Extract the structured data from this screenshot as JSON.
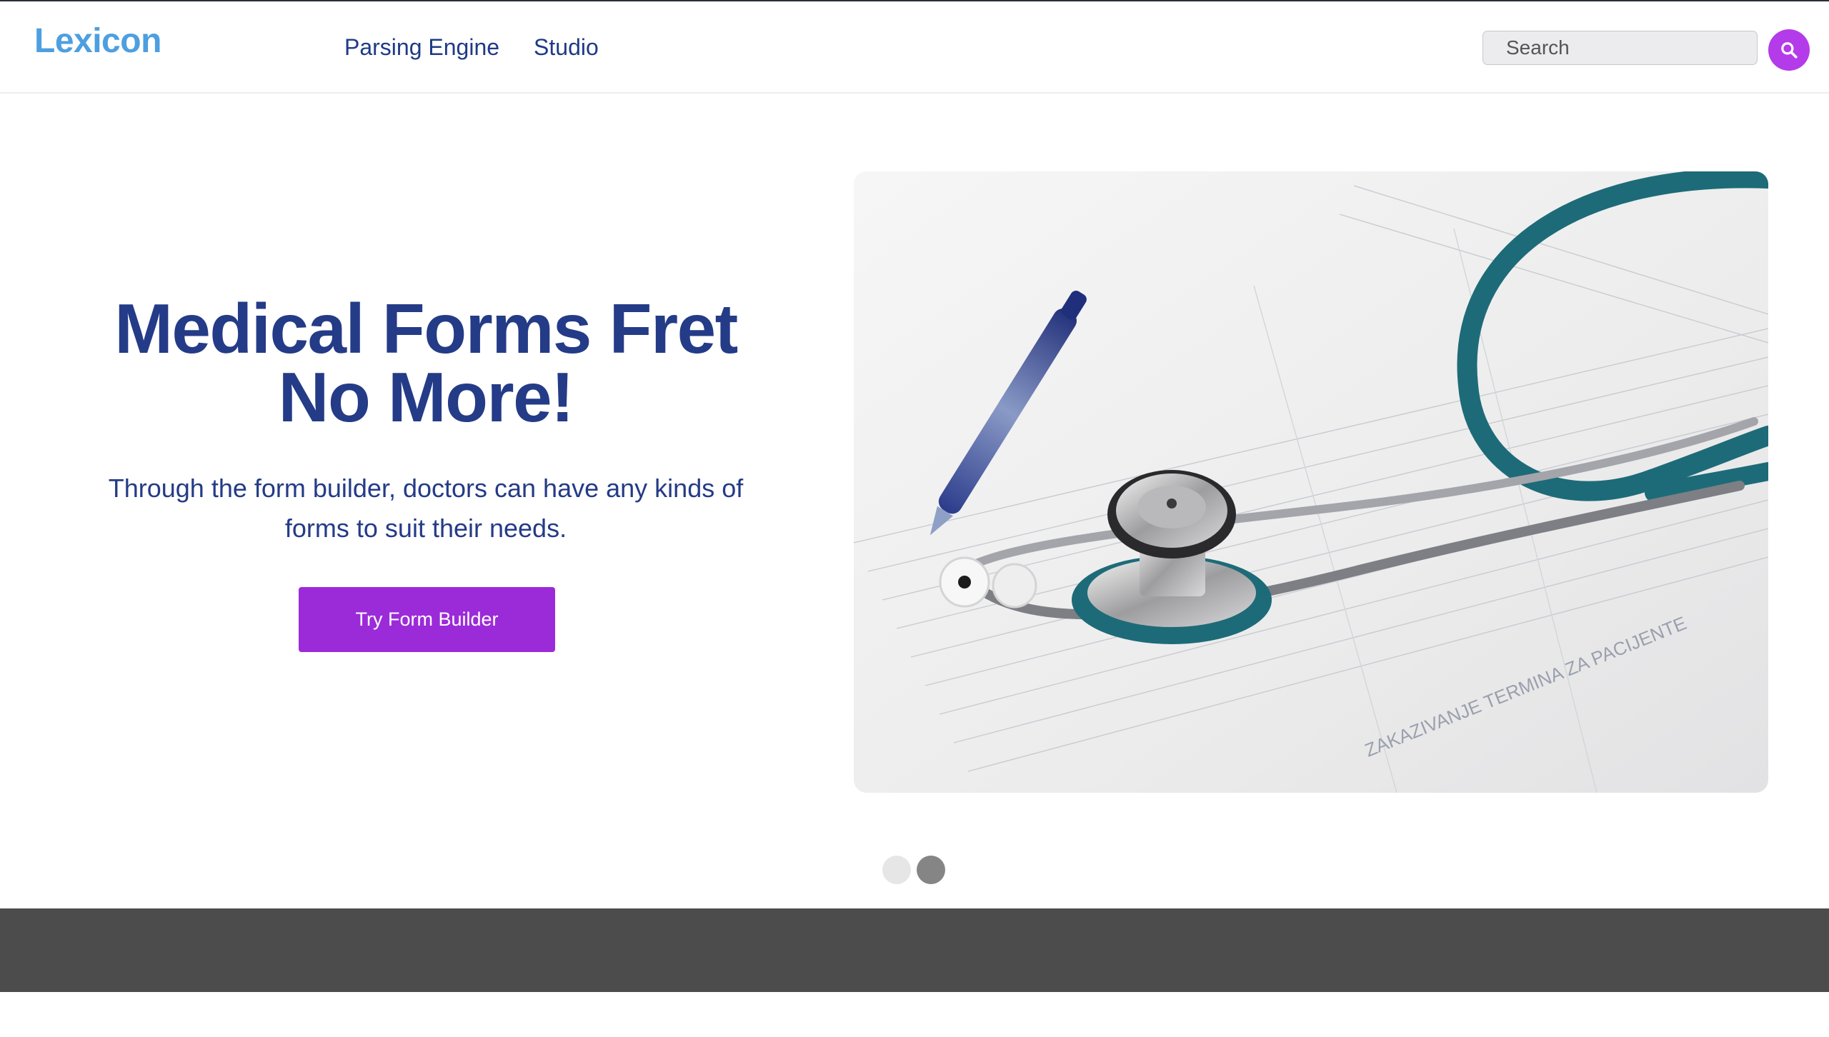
{
  "brand": {
    "name": "Lexicon",
    "color": "#4d9fe0"
  },
  "nav": {
    "links": [
      {
        "label": "Parsing Engine"
      },
      {
        "label": "Studio"
      }
    ]
  },
  "search": {
    "placeholder": "Search",
    "value": "",
    "button_icon": "search-icon",
    "button_color": "#b43be9"
  },
  "hero": {
    "title_line1": "Medical Forms Fret",
    "title_line2": "No More!",
    "subtitle_line1": "Through the form builder, doctors can have any kinds of",
    "subtitle_line2": "forms to suit their needs.",
    "cta_label": "Try Form Builder",
    "cta_color": "#9b2bd9",
    "image_subject": "stethoscope-and-pen-on-medical-form"
  },
  "carousel": {
    "slide_count": 2,
    "active_index": 1
  },
  "colors": {
    "heading": "#243b87",
    "footer": "#4c4c4c"
  }
}
